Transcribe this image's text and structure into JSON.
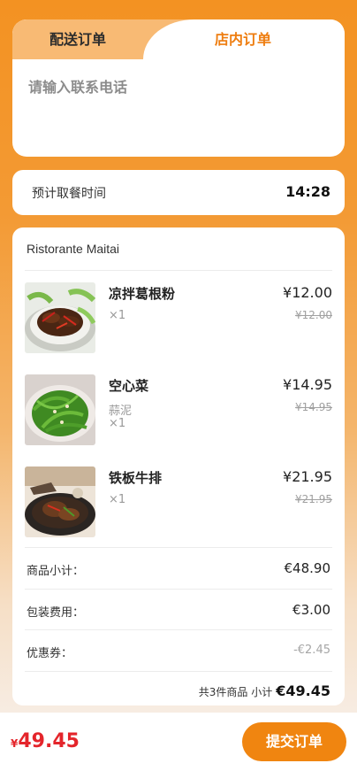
{
  "tabs": [
    {
      "label": "配送订单"
    },
    {
      "label": "店内订单",
      "active": true
    }
  ],
  "contact": {
    "placeholder": "请输入联系电话",
    "value": ""
  },
  "pickup": {
    "label": "预计取餐时间",
    "time": "14:28"
  },
  "store": {
    "name": "Ristorante Maitai"
  },
  "items": [
    {
      "name": "凉拌葛根粉",
      "qty": "×1",
      "spec": "",
      "price": "¥12.00",
      "original_price": "¥12.00",
      "image": "dish-photo-braised-meat"
    },
    {
      "name": "空心菜",
      "qty": "×1",
      "spec": "蒜泥",
      "price": "¥14.95",
      "original_price": "¥14.95",
      "image": "dish-photo-greens"
    },
    {
      "name": "铁板牛排",
      "qty": "×1",
      "spec": "",
      "price": "¥21.95",
      "original_price": "¥21.95",
      "image": "dish-photo-sizzling-steak"
    }
  ],
  "totals": {
    "subtotal_label": "商品小计：",
    "subtotal_value": "€48.90",
    "packing_label": "包装费用：",
    "packing_value": "€3.00",
    "coupon_label": "优惠券：",
    "coupon_value": "-€2.45",
    "summary_count": "共3件商品 小计",
    "summary_total": "€49.45"
  },
  "footer": {
    "currency": "¥",
    "amount": "49.45",
    "submit_label": "提交订单"
  },
  "colors": {
    "accent": "#f08510",
    "price_red": "#e4252b",
    "tab_active": "#ee7d10"
  }
}
